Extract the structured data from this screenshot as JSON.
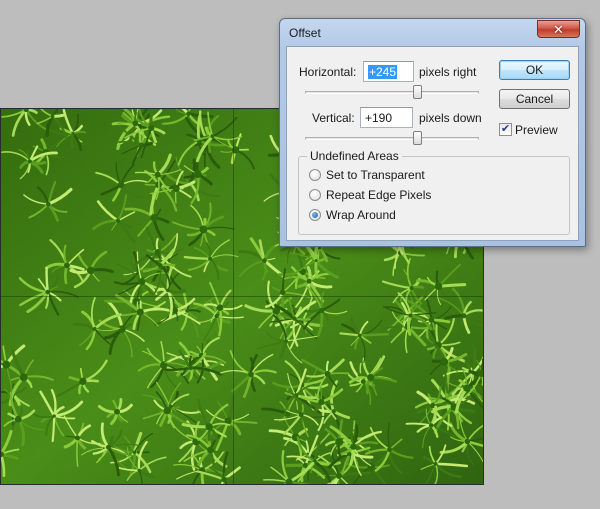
{
  "dialog": {
    "title": "Offset",
    "horizontal": {
      "label": "Horizontal:",
      "value": "+245",
      "unit": "pixels right"
    },
    "vertical": {
      "label": "Vertical:",
      "value": "+190",
      "unit": "pixels down"
    },
    "buttons": {
      "ok": "OK",
      "cancel": "Cancel"
    },
    "preview": {
      "label": "Preview",
      "checked": true
    },
    "undefined_areas": {
      "title": "Undefined Areas",
      "options": [
        {
          "label": "Set to Transparent",
          "selected": false
        },
        {
          "label": "Repeat Edge Pixels",
          "selected": false
        },
        {
          "label": "Wrap Around",
          "selected": true
        }
      ]
    }
  },
  "icons": {
    "close": "close-icon",
    "check": "checkmark-icon"
  },
  "colors": {
    "background": "#bdbdbd",
    "moss": "#3f7d15",
    "selection": "#3399ff",
    "close_button": "#c8432f"
  }
}
